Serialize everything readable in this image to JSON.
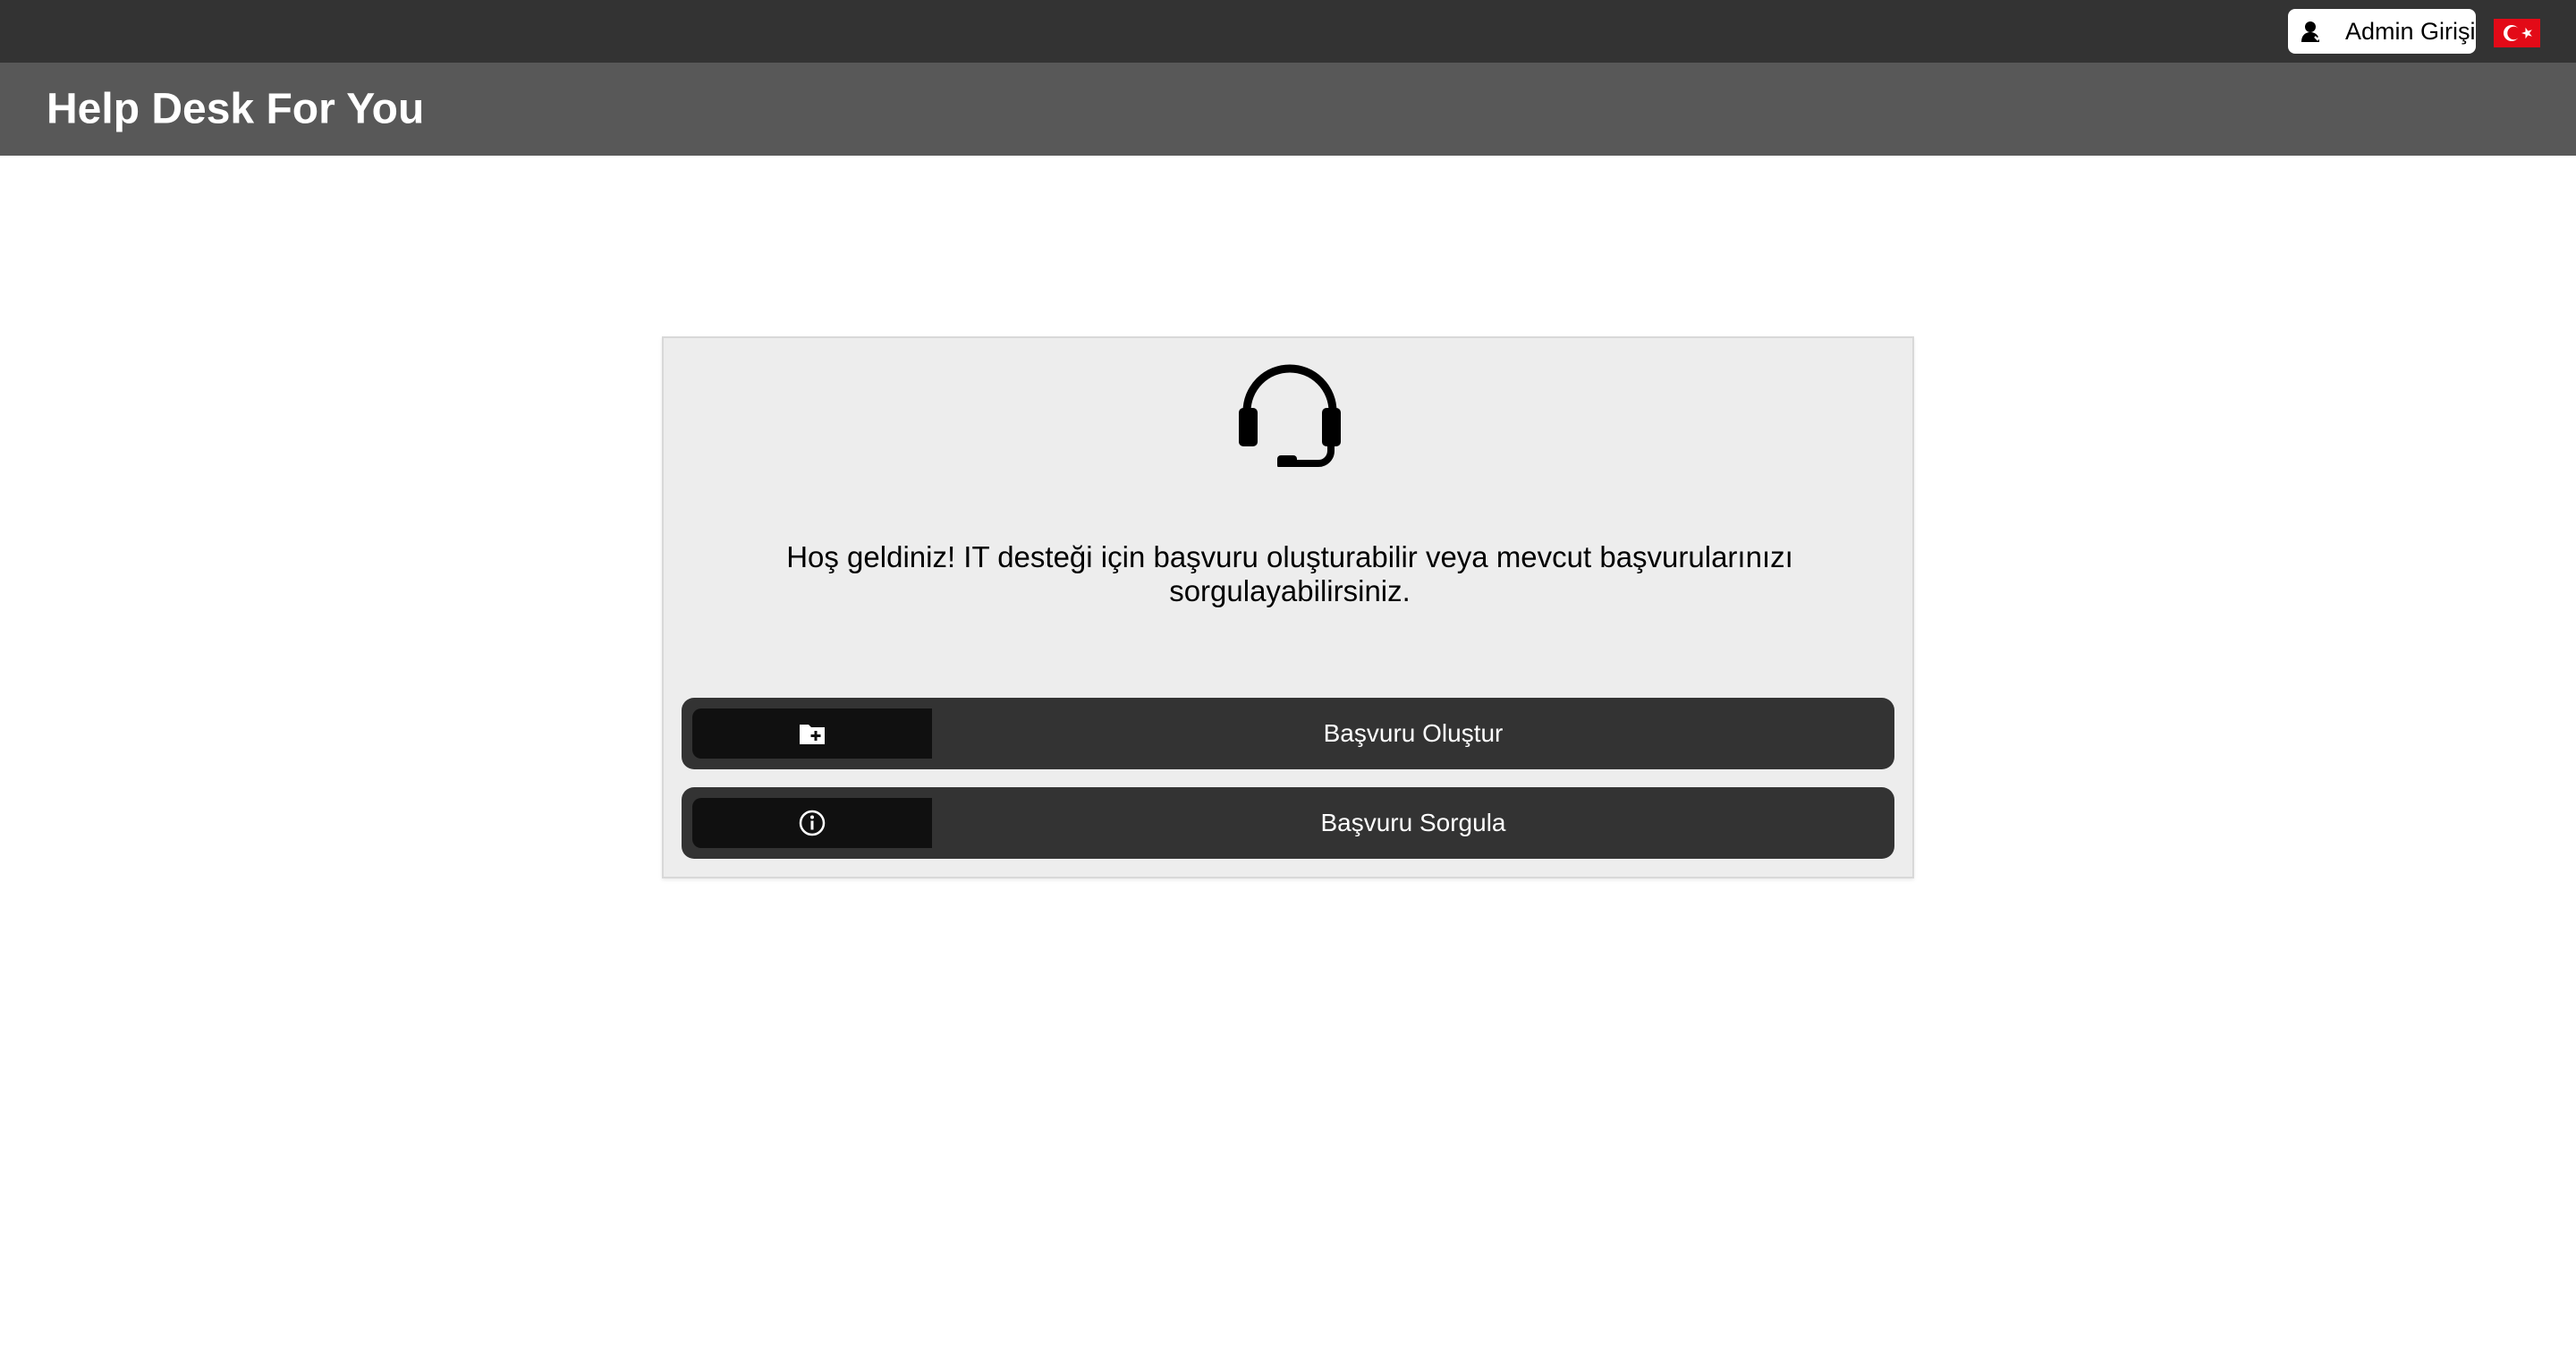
{
  "topbar": {
    "admin_label": "Admin Girişi",
    "admin_icon": "user-icon",
    "language_flag": "turkey-flag-icon"
  },
  "header": {
    "title": "Help Desk For You"
  },
  "card": {
    "icon": "headset-icon",
    "welcome_text": "Hoş geldiniz! IT desteği için başvuru oluşturabilir veya mevcut başvurularınızı sorgulayabilirsiniz.",
    "actions": [
      {
        "label": "Başvuru Oluştur",
        "icon": "folder-plus-icon"
      },
      {
        "label": "Başvuru Sorgula",
        "icon": "info-circle-icon"
      }
    ]
  },
  "colors": {
    "topbar": "#333333",
    "header": "#585858",
    "card_bg": "#ededed",
    "button_bg": "#333333",
    "button_icon_bg": "#101010",
    "flag_red": "#e30a17"
  }
}
